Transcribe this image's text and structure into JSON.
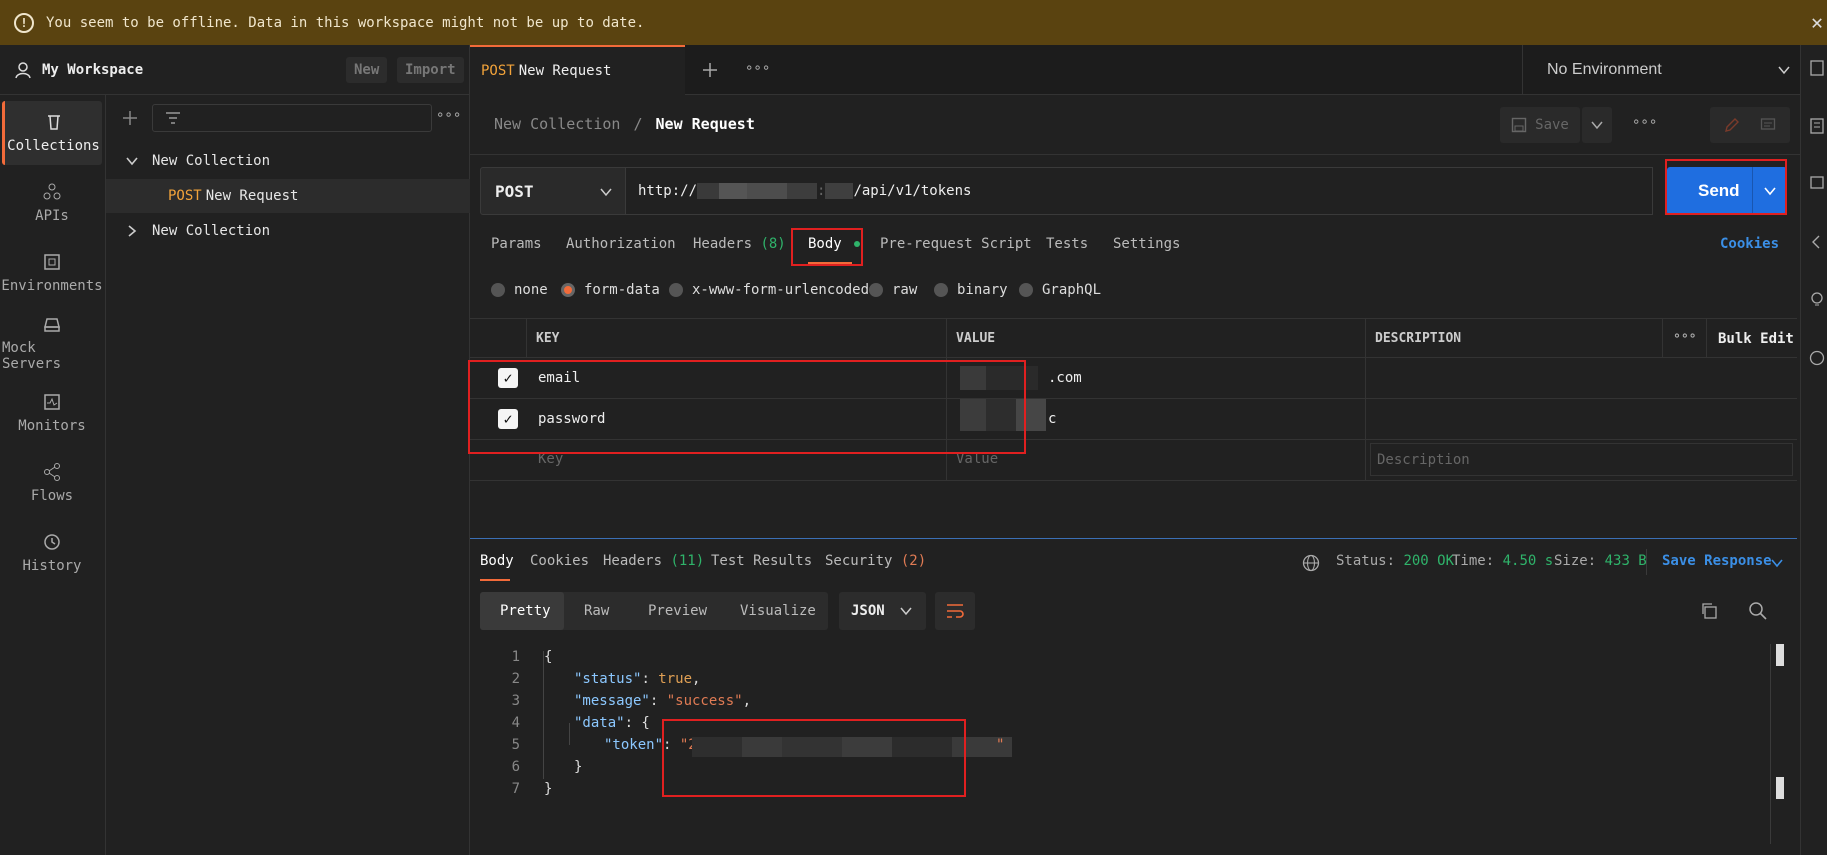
{
  "banner": {
    "message": "You seem to be offline. Data in this workspace might not be up to date.",
    "close_glyph": "✕"
  },
  "workspace": {
    "name": "My Workspace",
    "new_label": "New",
    "import_label": "Import"
  },
  "rail": [
    {
      "label": "Collections",
      "icon": "trash-can-icon"
    },
    {
      "label": "APIs",
      "icon": "apis-icon"
    },
    {
      "label": "Environments",
      "icon": "environments-icon"
    },
    {
      "label": "Mock Servers",
      "icon": "server-icon"
    },
    {
      "label": "Monitors",
      "icon": "monitor-icon"
    },
    {
      "label": "Flows",
      "icon": "flows-icon"
    },
    {
      "label": "History",
      "icon": "history-icon"
    }
  ],
  "tree": {
    "collection1": "New Collection",
    "request_method": "POST",
    "request_name": "New Request",
    "collection2": "New Collection"
  },
  "tab": {
    "method": "POST",
    "name": "New Request"
  },
  "environment": "No Environment",
  "breadcrumb": {
    "parent": "New Collection",
    "separator": "/",
    "current": "New Request"
  },
  "save_label": "Save",
  "request": {
    "method": "POST",
    "url_prefix": "http://",
    "url_mid": ":",
    "url_suffix": "/api/v1/tokens",
    "send_label": "Send"
  },
  "request_tabs": {
    "params": "Params",
    "authorization": "Authorization",
    "headers": "Headers",
    "headers_count": "(8)",
    "body": "Body",
    "prerequest": "Pre-request Script",
    "tests": "Tests",
    "settings": "Settings",
    "cookies": "Cookies"
  },
  "body_types": [
    "none",
    "form-data",
    "x-www-form-urlencoded",
    "raw",
    "binary",
    "GraphQL"
  ],
  "body_type_selected": "form-data",
  "table": {
    "headers": {
      "key": "KEY",
      "value": "VALUE",
      "description": "DESCRIPTION",
      "bulk_edit": "Bulk Edit"
    },
    "rows": [
      {
        "key": "email",
        "value_suffix": ".com"
      },
      {
        "key": "password",
        "value_suffix": "c"
      }
    ],
    "placeholders": {
      "key": "Key",
      "value": "Value",
      "description": "Description"
    }
  },
  "response": {
    "tabs": {
      "body": "Body",
      "cookies": "Cookies",
      "headers": "Headers",
      "headers_count": "(11)",
      "test_results": "Test Results",
      "security": "Security",
      "security_count": "(2)"
    },
    "status_label": "Status:",
    "status_value": "200 OK",
    "time_label": "Time:",
    "time_value": "4.50 s",
    "size_label": "Size:",
    "size_value": "433 B",
    "save_response": "Save Response",
    "views": [
      "Pretty",
      "Raw",
      "Preview",
      "Visualize"
    ],
    "format": "JSON",
    "code": {
      "l1": "{",
      "status_key": "\"status\"",
      "status_val": "true",
      "message_key": "\"message\"",
      "message_val": "\"success\"",
      "data_key": "\"data\"",
      "token_key": "\"token\"",
      "token_start": "\"2",
      "token_end": "\"",
      "close_inner": "}",
      "close_outer": "}",
      "line_numbers": [
        "1",
        "2",
        "3",
        "4",
        "5",
        "6",
        "7"
      ]
    }
  },
  "colors": {
    "accent": "#f26b3a",
    "send": "#1f6ee0",
    "highlight_box": "#e02020",
    "success": "#2fb36a",
    "banner": "#5a4310"
  }
}
